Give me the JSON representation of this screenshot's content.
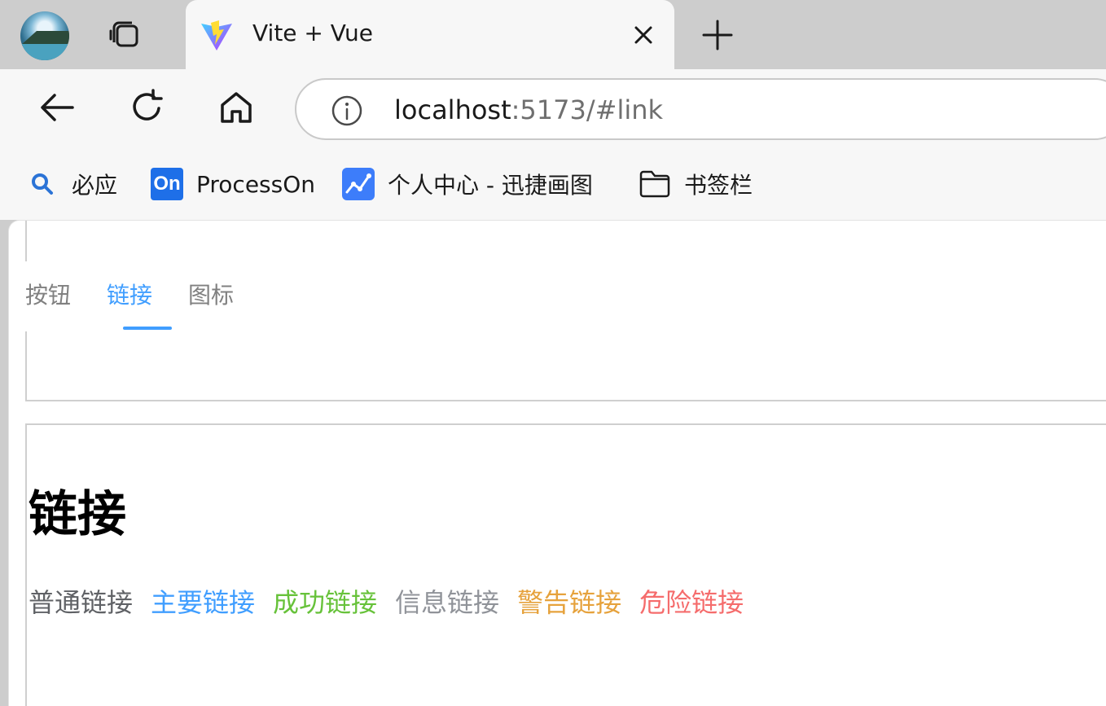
{
  "browser": {
    "tab_title": "Vite + Vue",
    "address_host": "localhost",
    "address_rest": ":5173/#link",
    "bookmarks": [
      {
        "label": "必应",
        "icon": "search-icon"
      },
      {
        "label": "ProcessOn",
        "icon": "processon-icon",
        "badge": "On"
      },
      {
        "label": "个人中心 - 迅捷画图",
        "icon": "xunjie-icon"
      },
      {
        "label": "书签栏",
        "icon": "folder-icon"
      }
    ]
  },
  "page": {
    "tabs": [
      {
        "label": "按钮",
        "active": false
      },
      {
        "label": "链接",
        "active": true
      },
      {
        "label": "图标",
        "active": false
      }
    ],
    "section_title": "链接",
    "links": [
      {
        "label": "普通链接",
        "color": "#606266"
      },
      {
        "label": "主要链接",
        "color": "#409eff"
      },
      {
        "label": "成功链接",
        "color": "#67c23a"
      },
      {
        "label": "信息链接",
        "color": "#909399"
      },
      {
        "label": "警告链接",
        "color": "#e6a23c"
      },
      {
        "label": "危险链接",
        "color": "#f56c6c"
      }
    ]
  }
}
